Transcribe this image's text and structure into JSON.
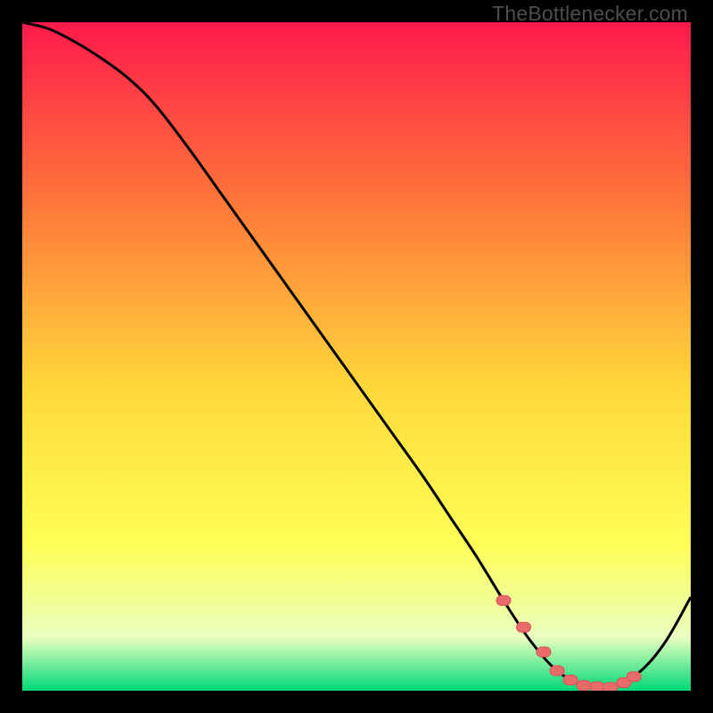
{
  "watermark": "TheBottlenecker.com",
  "colors": {
    "gradient_top": "#ff1a4b",
    "gradient_mid1": "#ff7a3a",
    "gradient_mid2": "#ffd93a",
    "gradient_mid3": "#ffff55",
    "gradient_mid4": "#e9ffbf",
    "gradient_bottom": "#00d877",
    "curve": "#000000",
    "marker_fill": "#e86a6a",
    "marker_stroke": "#d95555",
    "bg": "#000000"
  },
  "chart_data": {
    "type": "line",
    "title": "",
    "xlabel": "",
    "ylabel": "",
    "xlim": [
      0,
      100
    ],
    "ylim": [
      0,
      100
    ],
    "grid": false,
    "series": [
      {
        "name": "curve",
        "x": [
          0,
          4,
          8,
          12,
          16,
          20,
          25,
          30,
          35,
          40,
          45,
          50,
          55,
          60,
          64,
          68,
          72,
          76,
          80,
          84,
          88,
          92,
          96,
          100
        ],
        "y": [
          100,
          99,
          97,
          94.5,
          91.5,
          87.5,
          81,
          74,
          67,
          60,
          53,
          46,
          39,
          32,
          26,
          20,
          13.5,
          7.5,
          3,
          0.8,
          0.5,
          2.5,
          7,
          14
        ]
      }
    ],
    "markers": {
      "name": "highlight-points",
      "x": [
        72,
        75,
        78,
        80,
        82,
        84,
        86,
        88,
        90,
        91.5
      ],
      "y": [
        13.5,
        9.5,
        5.8,
        3,
        1.6,
        0.8,
        0.6,
        0.5,
        1.2,
        2.1
      ]
    }
  }
}
